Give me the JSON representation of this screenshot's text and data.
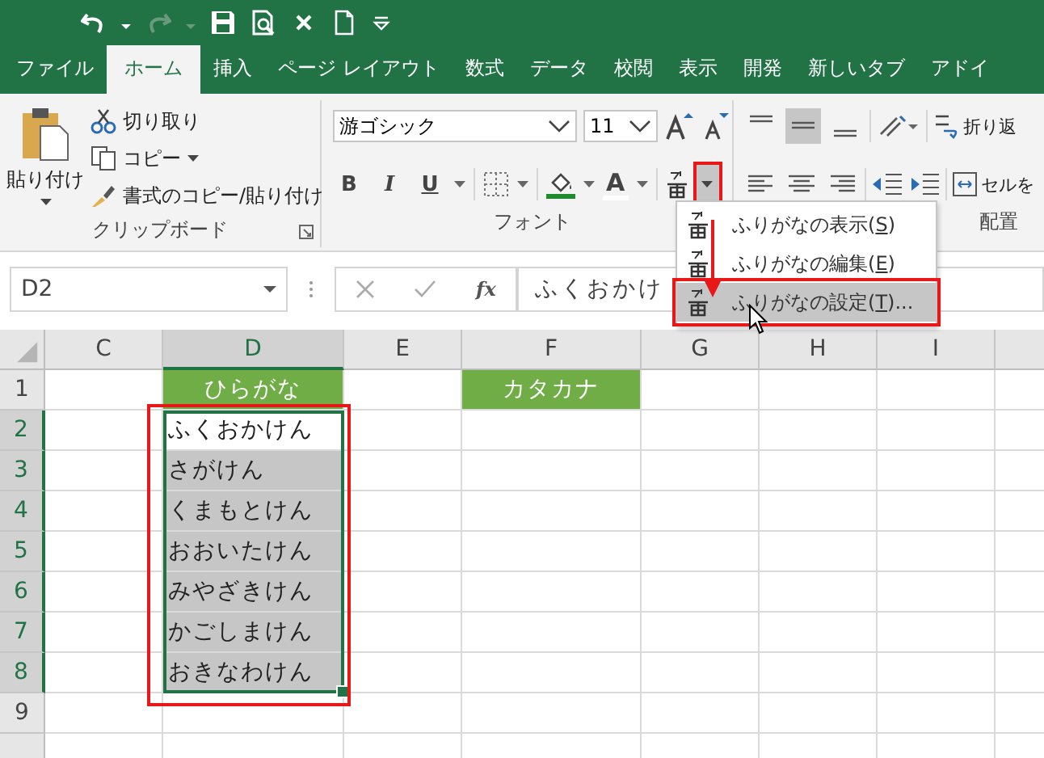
{
  "tabs": [
    {
      "label": "ファイル",
      "selected": false
    },
    {
      "label": "ホーム",
      "selected": true
    },
    {
      "label": "挿入",
      "selected": false
    },
    {
      "label": "ページ レイアウト",
      "selected": false
    },
    {
      "label": "数式",
      "selected": false
    },
    {
      "label": "データ",
      "selected": false
    },
    {
      "label": "校閲",
      "selected": false
    },
    {
      "label": "表示",
      "selected": false
    },
    {
      "label": "開発",
      "selected": false
    },
    {
      "label": "新しいタブ",
      "selected": false
    },
    {
      "label": "アドイ",
      "selected": false
    }
  ],
  "clipboard": {
    "paste": "貼り付け",
    "cut": "切り取り",
    "copy": "コピー",
    "format_painter": "書式のコピー/貼り付け",
    "group_label": "クリップボード"
  },
  "font": {
    "font_name": "游ゴシック",
    "font_size": "11",
    "bold": "B",
    "italic": "I",
    "underline": "U",
    "font_color": "A",
    "group_label": "フォント",
    "ruby_dropdown_outlined": true
  },
  "alignment": {
    "group_label": "配置",
    "wrap_text": "折り返",
    "merge": "セルを",
    "middle_align_on": true
  },
  "ruby_menu": [
    {
      "before": "ふりがなの表示(",
      "accel": "S",
      "after": ")",
      "selected": false,
      "outlined": false
    },
    {
      "before": "ふりがなの編集(",
      "accel": "E",
      "after": ")",
      "selected": false,
      "outlined": false
    },
    {
      "before": "ふりがなの設定(",
      "accel": "T",
      "after": ")...",
      "selected": true,
      "outlined": true
    }
  ],
  "formula_bar": {
    "name_box": "D2",
    "fx": "fx",
    "formula": "ふくおかけ"
  },
  "sheet": {
    "columns": [
      {
        "label": "C",
        "selected": false
      },
      {
        "label": "D",
        "selected": true
      },
      {
        "label": "E",
        "selected": false
      },
      {
        "label": "F",
        "selected": false
      },
      {
        "label": "G",
        "selected": false
      },
      {
        "label": "H",
        "selected": false
      },
      {
        "label": "I",
        "selected": false
      }
    ],
    "range_outlined": true,
    "rows": [
      {
        "label": "1",
        "selected": false,
        "kind": "header",
        "cells": [
          "",
          "ひらがな",
          "",
          "カタカナ"
        ]
      },
      {
        "label": "2",
        "selected": true,
        "kind": "active",
        "cells": [
          "",
          "ふくおかけん"
        ]
      },
      {
        "label": "3",
        "selected": true,
        "kind": "selected",
        "cells": [
          "",
          "さがけん"
        ]
      },
      {
        "label": "4",
        "selected": true,
        "kind": "selected",
        "cells": [
          "",
          "くまもとけん"
        ]
      },
      {
        "label": "5",
        "selected": true,
        "kind": "selected",
        "cells": [
          "",
          "おおいたけん"
        ]
      },
      {
        "label": "6",
        "selected": true,
        "kind": "selected",
        "cells": [
          "",
          "みやざきけん"
        ]
      },
      {
        "label": "7",
        "selected": true,
        "kind": "selected",
        "cells": [
          "",
          "かごしまけん"
        ]
      },
      {
        "label": "8",
        "selected": true,
        "kind": "selected",
        "cells": [
          "",
          "おきなわけん"
        ]
      },
      {
        "label": "9",
        "selected": false,
        "cells": []
      }
    ]
  }
}
